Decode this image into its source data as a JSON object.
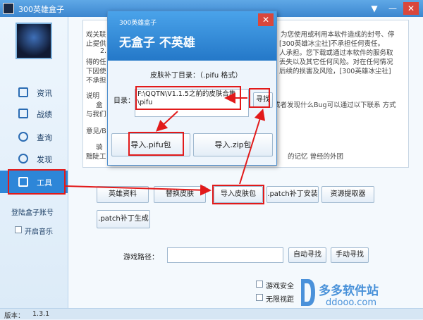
{
  "window": {
    "title": "300英雄盒子"
  },
  "sidebar": {
    "items": [
      {
        "label": "资讯",
        "icon": "news-icon"
      },
      {
        "label": "战绩",
        "icon": "record-icon"
      },
      {
        "label": "查询",
        "icon": "user-search-icon"
      },
      {
        "label": "发现",
        "icon": "discover-icon"
      },
      {
        "label": "工具",
        "icon": "tools-grid-icon"
      }
    ],
    "login_label": "登陆盒子账号",
    "music_label": "开启音乐"
  },
  "content": {
    "lines": [
      "戏关联",
      "止提供",
      "2.",
      "得的任",
      "下因使",
      "不承担",
      "说明",
      "盒",
      "与我们",
      "意见/B",
      "骑",
      "黜陡工"
    ],
    "right_lines": [
      "为您使用或利用本软件造成的封号、停",
      "[300英雄冰尘社]不承担任何责任。",
      "人承担。您下载或通过本软件的服务取",
      "丢失以及其它任何风险。对在任何情况",
      "后续的损害及风险，[300英雄冰尘社]",
      "或者发现什么Bug可以通过以下联系 方式",
      "的记忆   曾经的外团"
    ]
  },
  "tools": {
    "row1": [
      "英雄资料",
      "替换皮肤",
      "导入皮肤包",
      ".patch补丁安装",
      "资源提取器"
    ],
    "row2": [
      ".patch补丁生成"
    ],
    "game_path_label": "游戏路径：",
    "auto_find": "自动寻找",
    "manual_find": "手动寻找"
  },
  "bottom_checks": {
    "game_safe": "游戏安全",
    "borderless": "无限视距"
  },
  "status": {
    "version_label": "版本：",
    "version": "1.3.1"
  },
  "dialog": {
    "brand": "300英雄盒子",
    "slogan": "无盒子  不英雄",
    "dir_hint": "皮肤补丁目录：（.pifu 格式）",
    "dir_label": "目录：",
    "path_value": "F:\\QQTN\\V1.1.5之前的皮肤合集\\pifu",
    "find_button": "寻找",
    "import_pifu": "导入.pifu包",
    "import_zip": "导入.zip包"
  },
  "watermark": {
    "text": "多多软件站",
    "url": "ddooo.com"
  },
  "colors": {
    "accent": "#2d86d8",
    "highlight": "#e21a1a"
  }
}
